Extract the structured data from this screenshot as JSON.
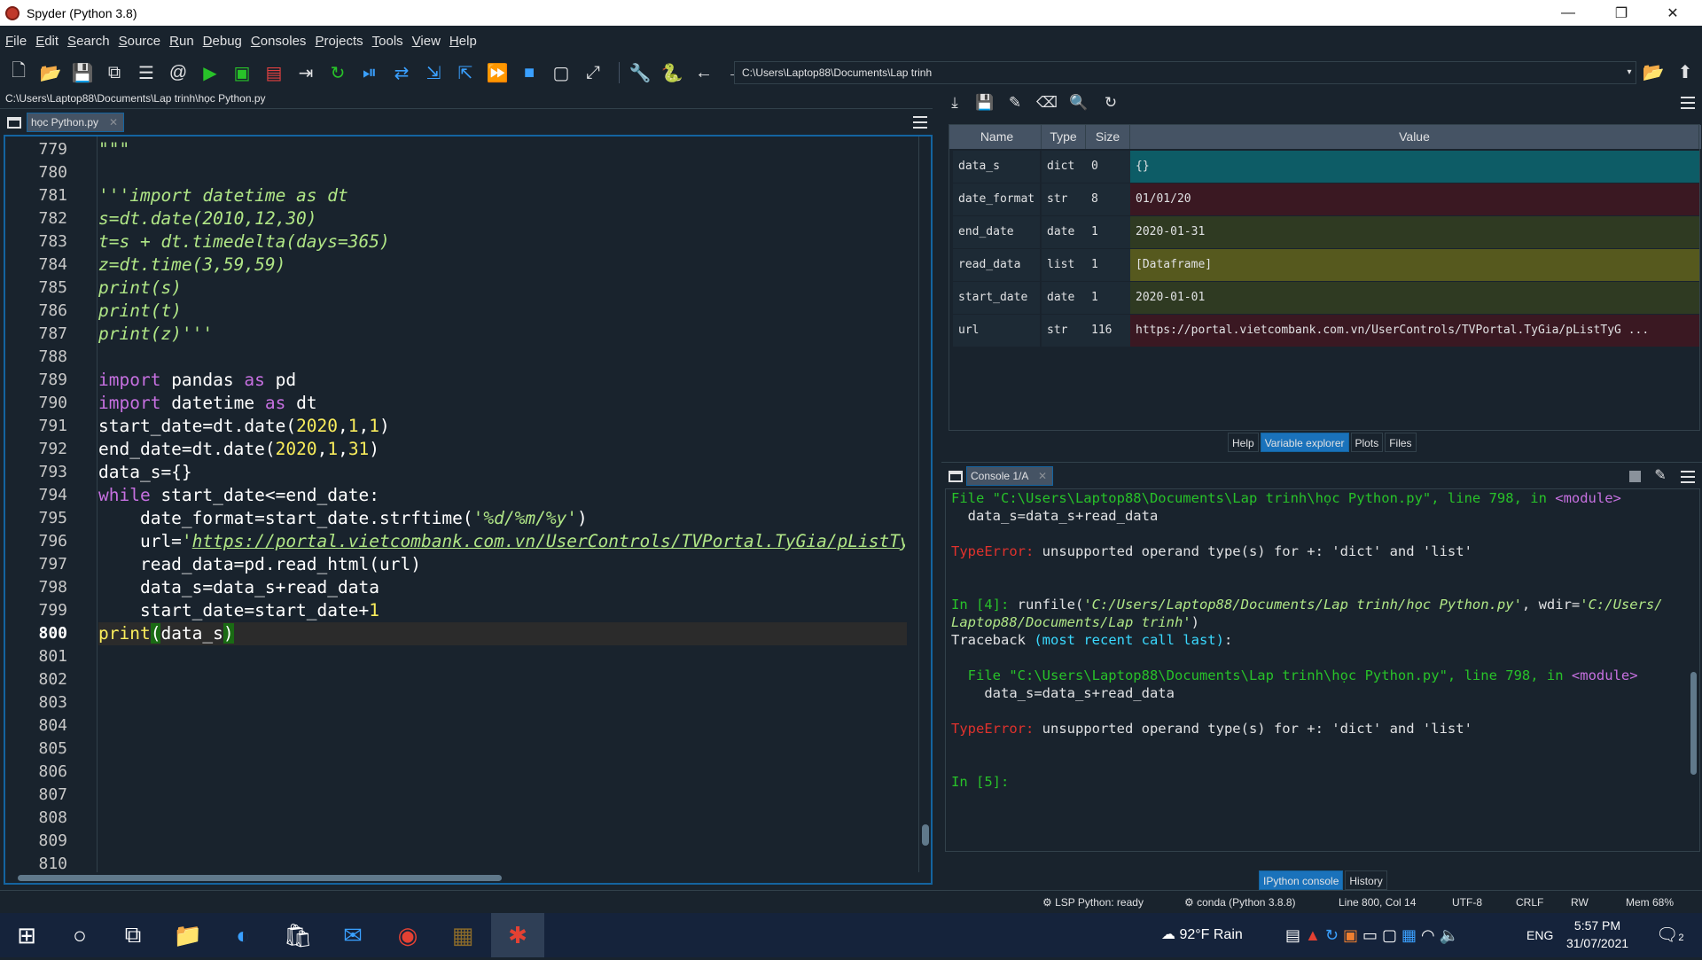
{
  "window": {
    "title": "Spyder (Python 3.8)",
    "minimize": "—",
    "maximize": "❐",
    "close": "✕"
  },
  "menu": [
    "File",
    "Edit",
    "Search",
    "Source",
    "Run",
    "Debug",
    "Consoles",
    "Projects",
    "Tools",
    "View",
    "Help"
  ],
  "toolbar": {
    "icons": [
      "new-file",
      "open-file",
      "save",
      "save-all",
      "outline",
      "at",
      "run",
      "run-cell",
      "run-cell-advance",
      "run-selection",
      "rerun",
      "debug",
      "step",
      "step-into",
      "step-return",
      "continue",
      "stop",
      "maximize",
      "fullscreen",
      "preferences",
      "python-path",
      "back",
      "forward"
    ],
    "working_dir": "C:\\Users\\Laptop88\\Documents\\Lap trinh"
  },
  "editor": {
    "file_path": "C:\\Users\\Laptop88\\Documents\\Lap trinh\\học Python.py",
    "tab_label": "học Python.py",
    "current_line": 800,
    "line_numbers": [
      "779",
      "780",
      "781",
      "782",
      "783",
      "784",
      "785",
      "786",
      "787",
      "788",
      "789",
      "790",
      "791",
      "792",
      "793",
      "794",
      "795",
      "796",
      "797",
      "798",
      "799",
      "800",
      "801",
      "802",
      "803",
      "804",
      "805",
      "806",
      "807",
      "808",
      "809",
      "810"
    ],
    "code": {
      "l779": "\"\"\"",
      "l781": "'''import datetime as dt",
      "l782": "s=dt.date(2010,12,30)",
      "l783": "t=s + dt.timedelta(days=365)",
      "l784": "z=dt.time(3,59,59)",
      "l785": "print(s)",
      "l786": "print(t)",
      "l787": "print(z)'''",
      "l789a": "import",
      "l789b": " pandas ",
      "l789c": "as",
      "l789d": " pd",
      "l790a": "import",
      "l790b": " datetime ",
      "l790c": "as",
      "l790d": " dt",
      "l791a": "start_date=dt.date(",
      "l791b": "2020",
      "l791c": ",",
      "l791d": "1",
      "l791e": ",",
      "l791f": "1",
      "l791g": ")",
      "l792a": "end_date=dt.date(",
      "l792b": "2020",
      "l792c": ",",
      "l792d": "1",
      "l792e": ",",
      "l792f": "31",
      "l792g": ")",
      "l793": "data_s={}",
      "l794a": "while",
      "l794b": " start_date<=end_date:",
      "l795a": "    date_format=start_date.strftime(",
      "l795b": "'%d/%m/%y'",
      "l795c": ")",
      "l796a": "    url=",
      "l796b": "'",
      "l796c": "https://portal.vietcombank.com.vn/UserControls/TVPortal.TyGia/pListTyGia.aspx?txtN",
      "l797": "    read_data=pd.read_html(url)",
      "l798": "    data_s=data_s+read_data",
      "l799a": "    start_date=start_date+",
      "l799b": "1",
      "l800a": "print",
      "l800b": "(",
      "l800c": "data_s",
      "l800d": ")"
    }
  },
  "variable_explorer": {
    "columns": [
      "Name",
      "Type",
      "Size",
      "Value"
    ],
    "rows": [
      {
        "name": "data_s",
        "type": "dict",
        "size": "0",
        "value": "{}",
        "color": "#0d5c66"
      },
      {
        "name": "date_format",
        "type": "str",
        "size": "8",
        "value": "01/01/20",
        "color": "#3a1822"
      },
      {
        "name": "end_date",
        "type": "date",
        "size": "1",
        "value": "2020-01-31",
        "color": "#2f3a22"
      },
      {
        "name": "read_data",
        "type": "list",
        "size": "1",
        "value": "[Dataframe]",
        "color": "#56591e"
      },
      {
        "name": "start_date",
        "type": "date",
        "size": "1",
        "value": "2020-01-01",
        "color": "#2f3a22"
      },
      {
        "name": "url",
        "type": "str",
        "size": "116",
        "value": "https://portal.vietcombank.com.vn/UserControls/TVPortal.TyGia/pListTyG ...",
        "color": "#3a1822"
      }
    ],
    "tabs": [
      "Help",
      "Variable explorer",
      "Plots",
      "Files"
    ],
    "active_tab": "Variable explorer"
  },
  "console": {
    "tab_label": "Console 1/A",
    "lines": {
      "a1": "File \"C:\\Users\\Laptop88\\Documents\\Lap trinh\\học Python.py\"",
      "a2": ", line 798, in ",
      "a3": "<module>",
      "b1": "  data_s=data_s+read_data",
      "c1": "TypeError: ",
      "c2": "unsupported operand type(s) for +: 'dict' and 'list'",
      "d1": "In [",
      "d2": "4",
      "d3": "]: ",
      "d4": "runfile(",
      "d5": "'C:/Users/Laptop88/Documents/Lap trinh/học Python.py'",
      "d6": ", wdir=",
      "d7": "'C:/Users/",
      "e1": "Laptop88/Documents/Lap trinh'",
      "e2": ")",
      "f1": "Traceback ",
      "f2": "(most recent call last)",
      "f3": ":",
      "g1": "  File \"C:\\Users\\Laptop88\\Documents\\Lap trinh\\học Python.py\"",
      "g2": ", line 798, in ",
      "g3": "<module>",
      "h1": "    data_s=data_s+read_data",
      "i1": "TypeError: ",
      "i2": "unsupported operand type(s) for +: 'dict' and 'list'",
      "j1": "In [",
      "j2": "5",
      "j3": "]:"
    },
    "tabs": [
      "IPython console",
      "History"
    ],
    "active_tab": "IPython console"
  },
  "status": {
    "lsp": "LSP Python: ready",
    "env": "conda (Python 3.8.8)",
    "position": "Line 800, Col 14",
    "encoding": "UTF-8",
    "eol": "CRLF",
    "mode": "RW",
    "mem": "Mem 68%"
  },
  "taskbar": {
    "weather": "92°F  Rain",
    "lang": "ENG",
    "time": "5:57 PM",
    "date": "31/07/2021",
    "notifications": "2"
  }
}
